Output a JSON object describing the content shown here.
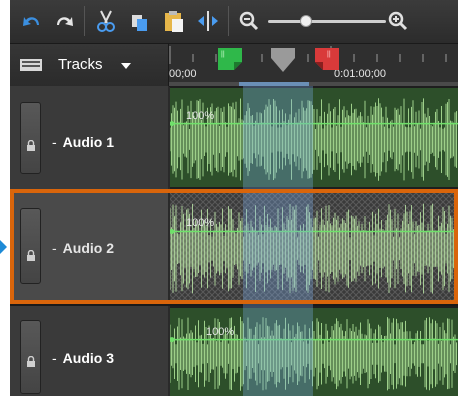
{
  "toolbar": {
    "buttons": [
      {
        "name": "undo-icon"
      },
      {
        "name": "redo-icon"
      },
      {
        "name": "cut-icon"
      },
      {
        "name": "copy-icon"
      },
      {
        "name": "paste-icon"
      },
      {
        "name": "split-icon"
      },
      {
        "name": "zoom-out-icon"
      },
      {
        "name": "zoom-in-icon"
      }
    ],
    "zoom_level": 0.35
  },
  "tracks_header": {
    "icon": "tracks-list-icon",
    "label": "Tracks",
    "dropdown_icon": "chevron-down-icon"
  },
  "ruler": {
    "ticks": [
      "00;00",
      "0:01:00;00"
    ],
    "markers": [
      {
        "name": "in-point-marker",
        "color": "#2fb84a"
      },
      {
        "name": "playhead",
        "color": "#9a9a9a"
      },
      {
        "name": "out-point-marker",
        "color": "#d93a3a"
      }
    ]
  },
  "tracks": [
    {
      "label": "Audio 1",
      "volume": "100%"
    },
    {
      "label": "Audio 2",
      "volume": "100%"
    },
    {
      "label": "Audio 3",
      "volume": "100%"
    }
  ],
  "colors": {
    "selection": "#d9650b",
    "waveform": "#9fd08d",
    "clip_bg": "#2d4f2a",
    "selection_band": "#78aae6"
  }
}
